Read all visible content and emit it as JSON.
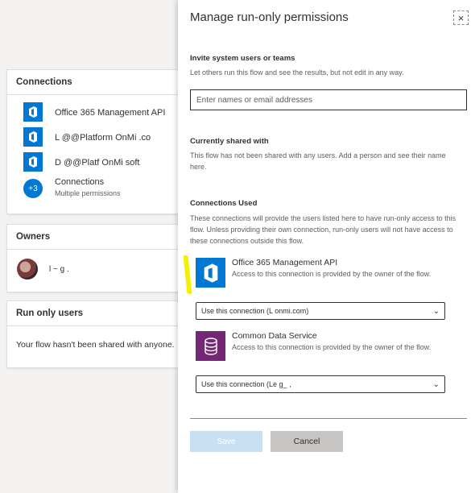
{
  "left": {
    "connections": {
      "title": "Connections",
      "items": [
        {
          "label": "Office 365 Management API",
          "icon": "office365-icon"
        },
        {
          "label": "L    @@Platform OnMi           .co",
          "icon": "office365-icon"
        },
        {
          "label": "D    @@Platf   OnMi        soft",
          "icon": "office365-icon"
        }
      ],
      "more": {
        "badge": "+3",
        "label": "Connections",
        "sub": "Multiple permissions"
      }
    },
    "owners": {
      "title": "Owners",
      "name": "l          ~ g ."
    },
    "run_only": {
      "title": "Run only users",
      "message": "Your flow hasn't been shared with anyone."
    }
  },
  "panel": {
    "title": "Manage run-only permissions",
    "close_glyph": "×",
    "invite": {
      "heading": "Invite system users or teams",
      "desc": "Let others run this flow and see the results, but not edit in any way.",
      "placeholder": "Enter names or email addresses"
    },
    "shared": {
      "heading": "Currently shared with",
      "desc": "This flow has not been shared with any users. Add a person and see their name here."
    },
    "connections_used": {
      "heading": "Connections Used",
      "desc": "These connections will provide the users listed here to have run-only access to this flow. Unless providing their own connection, run-only users will not have access to these connections outside this flow.",
      "items": [
        {
          "name": "Office 365 Management API",
          "note": "Access to this connection is provided by the owner of the flow.",
          "select": "Use this connection (L                              onmi.com)",
          "icon": "office365-icon",
          "color": "#0078d4"
        },
        {
          "name": "Common Data Service",
          "note": "Access to this connection is provided by the owner of the flow.",
          "select": "Use this connection (Le    g_                                 ,",
          "icon": "database-icon",
          "color": "#742774"
        }
      ]
    },
    "buttons": {
      "save": "Save",
      "cancel": "Cancel"
    }
  }
}
